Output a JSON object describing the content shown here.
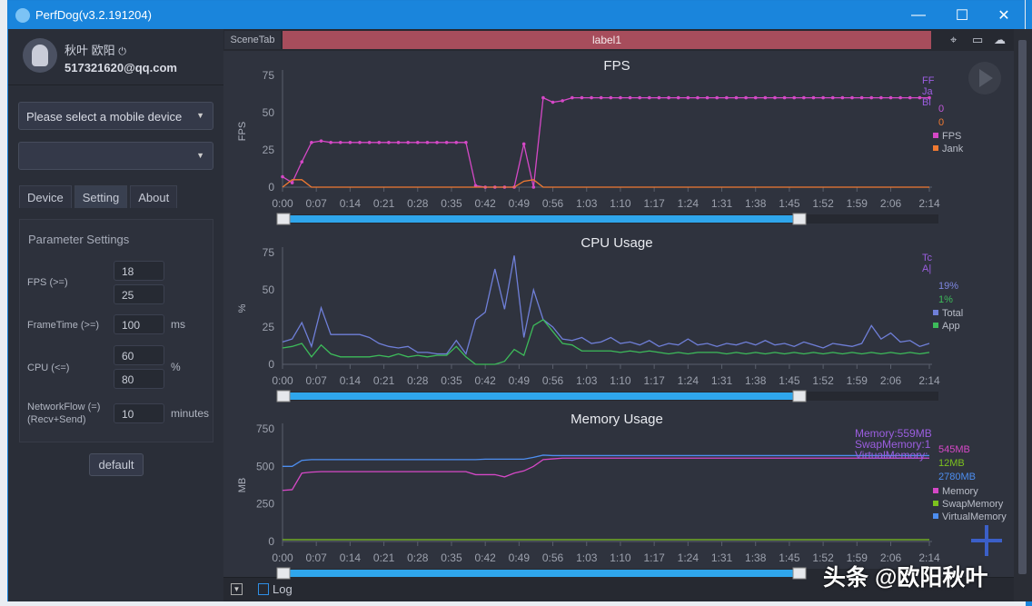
{
  "window": {
    "title": "PerfDog(v3.2.191204)",
    "min_icon": "minimize-icon",
    "max_icon": "maximize-icon",
    "close_icon": "close-icon"
  },
  "user": {
    "name": "秋叶 欧阳",
    "power_icon": "power-icon",
    "email": "517321620@qq.com"
  },
  "device_select": {
    "value": "Please select a mobile device"
  },
  "app_select": {
    "value": ""
  },
  "tabs": [
    {
      "label": "Device"
    },
    {
      "label": "Setting",
      "active": true
    },
    {
      "label": "About"
    }
  ],
  "params": {
    "title": "Parameter Settings",
    "fps_label": "FPS (>=)",
    "fps1": "18",
    "fps2": "25",
    "frametime_label": "FrameTime (>=)",
    "frametime": "100",
    "frametime_unit": "ms",
    "cpu_label": "CPU (<=)",
    "cpu1": "60",
    "cpu2": "80",
    "cpu_unit": "%",
    "net_label": "NetworkFlow (=)",
    "net_label2": "(Recv+Send)",
    "net": "10",
    "net_unit": "minutes",
    "default_label": "default"
  },
  "scene": {
    "tab": "SceneTab",
    "label": "label1",
    "icons": [
      "location-icon",
      "folder-icon",
      "cloud-icon"
    ]
  },
  "bottom": {
    "log_label": "Log"
  },
  "watermark": "头条 @欧阳秋叶",
  "colors": {
    "accent": "#1a85dc",
    "label_bar": "#a74d5c",
    "slider": "#2fa6ec"
  },
  "chart_data": [
    {
      "type": "line",
      "title": "FPS",
      "ylabel": "FPS",
      "ylim": [
        0,
        75
      ],
      "yticks": [
        0,
        25,
        50,
        75
      ],
      "xticks": [
        "0:00",
        "0:07",
        "0:14",
        "0:21",
        "0:28",
        "0:35",
        "0:42",
        "0:49",
        "0:56",
        "1:03",
        "1:10",
        "1:17",
        "1:24",
        "1:31",
        "1:38",
        "1:45",
        "1:52",
        "1:59",
        "2:06",
        "2:14"
      ],
      "xrange": [
        "0:00",
        "2:14"
      ],
      "x": [
        "0:00",
        "0:02",
        "0:04",
        "0:06",
        "0:08",
        "0:10",
        "0:12",
        "0:14",
        "0:16",
        "0:18",
        "0:20",
        "0:22",
        "0:24",
        "0:26",
        "0:28",
        "0:30",
        "0:32",
        "0:34",
        "0:36",
        "0:38",
        "0:40",
        "0:42",
        "0:44",
        "0:46",
        "0:48",
        "0:50",
        "0:52",
        "0:54",
        "0:56",
        "0:58",
        "1:00",
        "1:02",
        "1:04",
        "1:06",
        "1:08",
        "1:10",
        "1:12",
        "1:14",
        "1:16",
        "1:18",
        "1:20",
        "1:22",
        "1:24",
        "1:26",
        "1:28",
        "1:30",
        "1:32",
        "1:34",
        "1:36",
        "1:38",
        "1:40",
        "1:42",
        "1:44",
        "1:46",
        "1:48",
        "1:50",
        "1:52",
        "1:54",
        "1:56",
        "1:58",
        "2:00",
        "2:02",
        "2:04",
        "2:06",
        "2:08",
        "2:10",
        "2:12",
        "2:14"
      ],
      "series": [
        {
          "name": "FPS",
          "color": "#d548c6",
          "markers": true,
          "values": [
            7,
            3,
            17,
            30,
            31,
            30,
            30,
            30,
            30,
            30,
            30,
            30,
            30,
            30,
            30,
            30,
            30,
            30,
            30,
            30,
            1,
            0,
            0,
            0,
            0,
            29,
            0,
            60,
            57,
            58,
            60,
            60,
            60,
            60,
            60,
            60,
            60,
            60,
            60,
            60,
            60,
            60,
            60,
            60,
            60,
            60,
            60,
            60,
            60,
            60,
            60,
            60,
            60,
            60,
            60,
            60,
            60,
            60,
            60,
            60,
            60,
            60,
            60,
            60,
            60,
            60,
            60,
            60
          ]
        },
        {
          "name": "Jank",
          "color": "#f07a32",
          "values": [
            0,
            5,
            5,
            0,
            0,
            0,
            0,
            0,
            0,
            0,
            0,
            0,
            0,
            0,
            0,
            0,
            0,
            0,
            0,
            0,
            0,
            0,
            0,
            0,
            0,
            4,
            5,
            0,
            0,
            0,
            0,
            0,
            0,
            0,
            0,
            0,
            0,
            0,
            0,
            0,
            0,
            0,
            0,
            0,
            0,
            0,
            0,
            0,
            0,
            0,
            0,
            0,
            0,
            0,
            0,
            0,
            0,
            0,
            0,
            0,
            0,
            0,
            0,
            0,
            0,
            0,
            0,
            0
          ]
        }
      ],
      "overlay": [
        "FF",
        "Ja",
        "Bl"
      ],
      "current": [
        {
          "text": "0",
          "color": "#c158d8"
        },
        {
          "text": "0",
          "color": "#f07a32"
        }
      ]
    },
    {
      "type": "line",
      "title": "CPU Usage",
      "ylabel": "%",
      "ylim": [
        0,
        75
      ],
      "yticks": [
        0,
        25,
        50,
        75
      ],
      "xticks": [
        "0:00",
        "0:07",
        "0:14",
        "0:21",
        "0:28",
        "0:35",
        "0:42",
        "0:49",
        "0:56",
        "1:03",
        "1:10",
        "1:17",
        "1:24",
        "1:31",
        "1:38",
        "1:45",
        "1:52",
        "1:59",
        "2:06",
        "2:14"
      ],
      "xrange": [
        "0:00",
        "2:14"
      ],
      "x": [
        "0:00",
        "0:02",
        "0:04",
        "0:06",
        "0:08",
        "0:10",
        "0:12",
        "0:14",
        "0:16",
        "0:18",
        "0:20",
        "0:22",
        "0:24",
        "0:26",
        "0:28",
        "0:30",
        "0:32",
        "0:34",
        "0:36",
        "0:38",
        "0:40",
        "0:42",
        "0:44",
        "0:46",
        "0:48",
        "0:50",
        "0:52",
        "0:54",
        "0:56",
        "0:58",
        "1:00",
        "1:02",
        "1:04",
        "1:06",
        "1:08",
        "1:10",
        "1:12",
        "1:14",
        "1:16",
        "1:18",
        "1:20",
        "1:22",
        "1:24",
        "1:26",
        "1:28",
        "1:30",
        "1:32",
        "1:34",
        "1:36",
        "1:38",
        "1:40",
        "1:42",
        "1:44",
        "1:46",
        "1:48",
        "1:50",
        "1:52",
        "1:54",
        "1:56",
        "1:58",
        "2:00",
        "2:02",
        "2:04",
        "2:06",
        "2:08",
        "2:10",
        "2:12",
        "2:14"
      ],
      "series": [
        {
          "name": "Total",
          "color": "#6f7fd8",
          "values": [
            15,
            17,
            28,
            12,
            38,
            20,
            20,
            20,
            20,
            18,
            14,
            12,
            11,
            12,
            8,
            8,
            7,
            7,
            16,
            7,
            30,
            35,
            64,
            37,
            73,
            18,
            50,
            30,
            25,
            17,
            16,
            18,
            14,
            15,
            18,
            14,
            15,
            13,
            16,
            12,
            14,
            13,
            17,
            13,
            14,
            12,
            14,
            13,
            15,
            13,
            16,
            13,
            14,
            12,
            15,
            13,
            11,
            14,
            13,
            12,
            14,
            26,
            17,
            21,
            15,
            16,
            12,
            14
          ]
        },
        {
          "name": "App",
          "color": "#3dbb5a",
          "values": [
            11,
            12,
            14,
            5,
            13,
            7,
            5,
            5,
            5,
            5,
            6,
            5,
            7,
            5,
            6,
            5,
            6,
            6,
            12,
            5,
            0,
            0,
            0,
            2,
            10,
            6,
            26,
            30,
            22,
            14,
            13,
            9,
            9,
            9,
            9,
            8,
            9,
            8,
            9,
            8,
            7,
            8,
            7,
            8,
            8,
            8,
            7,
            8,
            7,
            8,
            7,
            8,
            7,
            8,
            7,
            8,
            7,
            8,
            7,
            8,
            7,
            8,
            7,
            8,
            7,
            8,
            7,
            8
          ]
        }
      ],
      "overlay": [
        "Tc",
        "A|"
      ],
      "current": [
        {
          "text": "19%",
          "color": "#7d86e0"
        },
        {
          "text": "1%",
          "color": "#3dbb5a"
        }
      ]
    },
    {
      "type": "line",
      "title": "Memory Usage",
      "ylabel": "MB",
      "ylim": [
        0,
        750
      ],
      "yticks": [
        0,
        250,
        500,
        750
      ],
      "xticks": [
        "0:00",
        "0:07",
        "0:14",
        "0:21",
        "0:28",
        "0:35",
        "0:42",
        "0:49",
        "0:56",
        "1:03",
        "1:10",
        "1:17",
        "1:24",
        "1:31",
        "1:38",
        "1:45",
        "1:52",
        "1:59",
        "2:06",
        "2:14"
      ],
      "xrange": [
        "0:00",
        "2:14"
      ],
      "x": [
        "0:00",
        "0:02",
        "0:04",
        "0:06",
        "0:08",
        "0:10",
        "0:12",
        "0:14",
        "0:16",
        "0:18",
        "0:20",
        "0:22",
        "0:24",
        "0:26",
        "0:28",
        "0:30",
        "0:32",
        "0:34",
        "0:36",
        "0:38",
        "0:40",
        "0:42",
        "0:44",
        "0:46",
        "0:48",
        "0:50",
        "0:52",
        "0:54",
        "0:56",
        "0:58",
        "1:00",
        "1:02",
        "1:04",
        "1:06",
        "1:08",
        "1:10",
        "1:12",
        "1:14",
        "1:16",
        "1:18",
        "1:20",
        "1:22",
        "1:24",
        "1:26",
        "1:28",
        "1:30",
        "1:32",
        "1:34",
        "1:36",
        "1:38",
        "1:40",
        "1:42",
        "1:44",
        "1:46",
        "1:48",
        "1:50",
        "1:52",
        "1:54",
        "1:56",
        "1:58",
        "2:00",
        "2:02",
        "2:04",
        "2:06",
        "2:08",
        "2:10",
        "2:12",
        "2:14"
      ],
      "series": [
        {
          "name": "Memory",
          "color": "#d548c6",
          "values": [
            340,
            345,
            455,
            462,
            465,
            465,
            465,
            465,
            465,
            465,
            465,
            465,
            465,
            465,
            465,
            465,
            465,
            465,
            465,
            465,
            445,
            445,
            445,
            430,
            455,
            470,
            500,
            545,
            550,
            555,
            555,
            555,
            555,
            555,
            555,
            555,
            555,
            555,
            555,
            555,
            555,
            555,
            555,
            555,
            555,
            555,
            555,
            555,
            555,
            555,
            555,
            555,
            555,
            555,
            555,
            555,
            555,
            555,
            555,
            555,
            555,
            555,
            555,
            555,
            555,
            555,
            555,
            555
          ]
        },
        {
          "name": "SwapMemory",
          "color": "#7cc21e",
          "values": [
            12,
            12,
            12,
            12,
            12,
            12,
            12,
            12,
            12,
            12,
            12,
            12,
            12,
            12,
            12,
            12,
            12,
            12,
            12,
            12,
            12,
            12,
            12,
            12,
            12,
            12,
            12,
            12,
            12,
            12,
            12,
            12,
            12,
            12,
            12,
            12,
            12,
            12,
            12,
            12,
            12,
            12,
            12,
            12,
            12,
            12,
            12,
            12,
            12,
            12,
            12,
            12,
            12,
            12,
            12,
            12,
            12,
            12,
            12,
            12,
            12,
            12,
            12,
            12,
            12,
            12,
            12,
            12
          ]
        },
        {
          "name": "VirtualMemory",
          "color": "#4d8ef0",
          "values": [
            500,
            500,
            540,
            545,
            545,
            545,
            545,
            545,
            545,
            545,
            545,
            545,
            545,
            545,
            545,
            545,
            545,
            545,
            545,
            545,
            545,
            548,
            548,
            548,
            548,
            548,
            560,
            575,
            572,
            572,
            572,
            572,
            572,
            572,
            572,
            572,
            572,
            572,
            572,
            572,
            572,
            572,
            572,
            572,
            572,
            572,
            572,
            572,
            572,
            572,
            572,
            572,
            572,
            572,
            572,
            572,
            572,
            572,
            572,
            572,
            572,
            572,
            572,
            572,
            572,
            572,
            572,
            572
          ]
        }
      ],
      "overlay": [
        "Memory:559MB",
        "SwapMemory:1",
        "VirtualMemory:"
      ],
      "current": [
        {
          "text": "545MB",
          "color": "#d548c6"
        },
        {
          "text": "12MB",
          "color": "#7cc21e"
        },
        {
          "text": "2780MB",
          "color": "#4d8ef0"
        }
      ]
    }
  ]
}
